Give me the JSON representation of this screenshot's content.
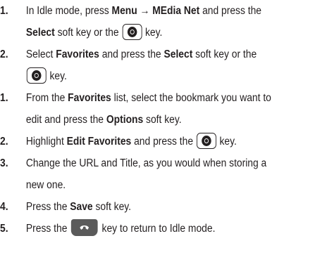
{
  "steps": [
    {
      "number": "1.",
      "parts": [
        "In Idle mode, press ",
        "Menu → MEdia Net",
        " and press the",
        "Select",
        " soft key or the ",
        " key."
      ]
    },
    {
      "number": "2.",
      "parts": [
        "Select ",
        "Favorites",
        " and press the ",
        "Select",
        " soft key or the",
        " key."
      ]
    },
    {
      "number": "1.",
      "parts": [
        "From the ",
        "Favorites",
        " list, select the bookmark you want to",
        "edit and press the ",
        "Options",
        " soft key."
      ]
    },
    {
      "number": "2.",
      "parts": [
        "Highlight ",
        "Edit Favorites",
        " and press the ",
        " key."
      ]
    },
    {
      "number": "3.",
      "parts": [
        "Change the URL and Title, as you would when storing a",
        "new one."
      ]
    },
    {
      "number": "4.",
      "parts": [
        "Press the ",
        "Save",
        " soft key."
      ]
    },
    {
      "number": "5.",
      "parts": [
        "Press the ",
        " key to return to Idle mode."
      ]
    }
  ],
  "icons": {
    "select_key": "select-key-icon",
    "end_key": "end-key-icon"
  }
}
